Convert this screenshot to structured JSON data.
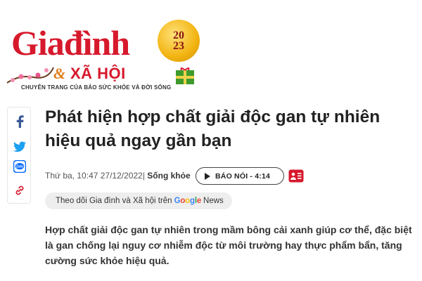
{
  "header": {
    "logo_main": "Giađình",
    "logo_amp": "&",
    "logo_sub": "XÃ HỘI",
    "logo_tagline": "CHUYÊN TRANG CỦA BÁO SỨC KHỎE VÀ ĐỜI SỐNG",
    "badge_top": "20",
    "badge_bottom": "23"
  },
  "social": {
    "items": [
      {
        "icon": "facebook-icon",
        "color": "#3b5998"
      },
      {
        "icon": "twitter-icon",
        "color": "#1da1f2"
      },
      {
        "icon": "zalo-icon",
        "color": "#0068ff"
      },
      {
        "icon": "link-icon",
        "color": "#d7192c"
      }
    ]
  },
  "article": {
    "title": "Phát hiện hợp chất giải độc gan tự nhiên hiệu quả ngay gần bạn",
    "meta": {
      "datetime": "Thứ ba, 10:47 27/12/2022",
      "separator": "|",
      "category": "Sống khỏe"
    },
    "audio_label": "BÁO NÓI - 4:14",
    "follow": {
      "prefix": "Theo dõi Gia đình và Xã hội trên",
      "google": "Google",
      "news": "News"
    },
    "summary": "Hợp chất giải độc gan tự nhiên trong mầm bông cải xanh giúp cơ thể, đặc biệt là gan chống lại nguy cơ nhiễm độc từ môi trường hay thực phẩm bẩn, tăng cường sức khỏe hiệu quả."
  },
  "colors": {
    "brand_red": "#d7192c",
    "brand_orange": "#e07c1a",
    "text": "#222222",
    "pill_bg": "#eeeeee"
  }
}
